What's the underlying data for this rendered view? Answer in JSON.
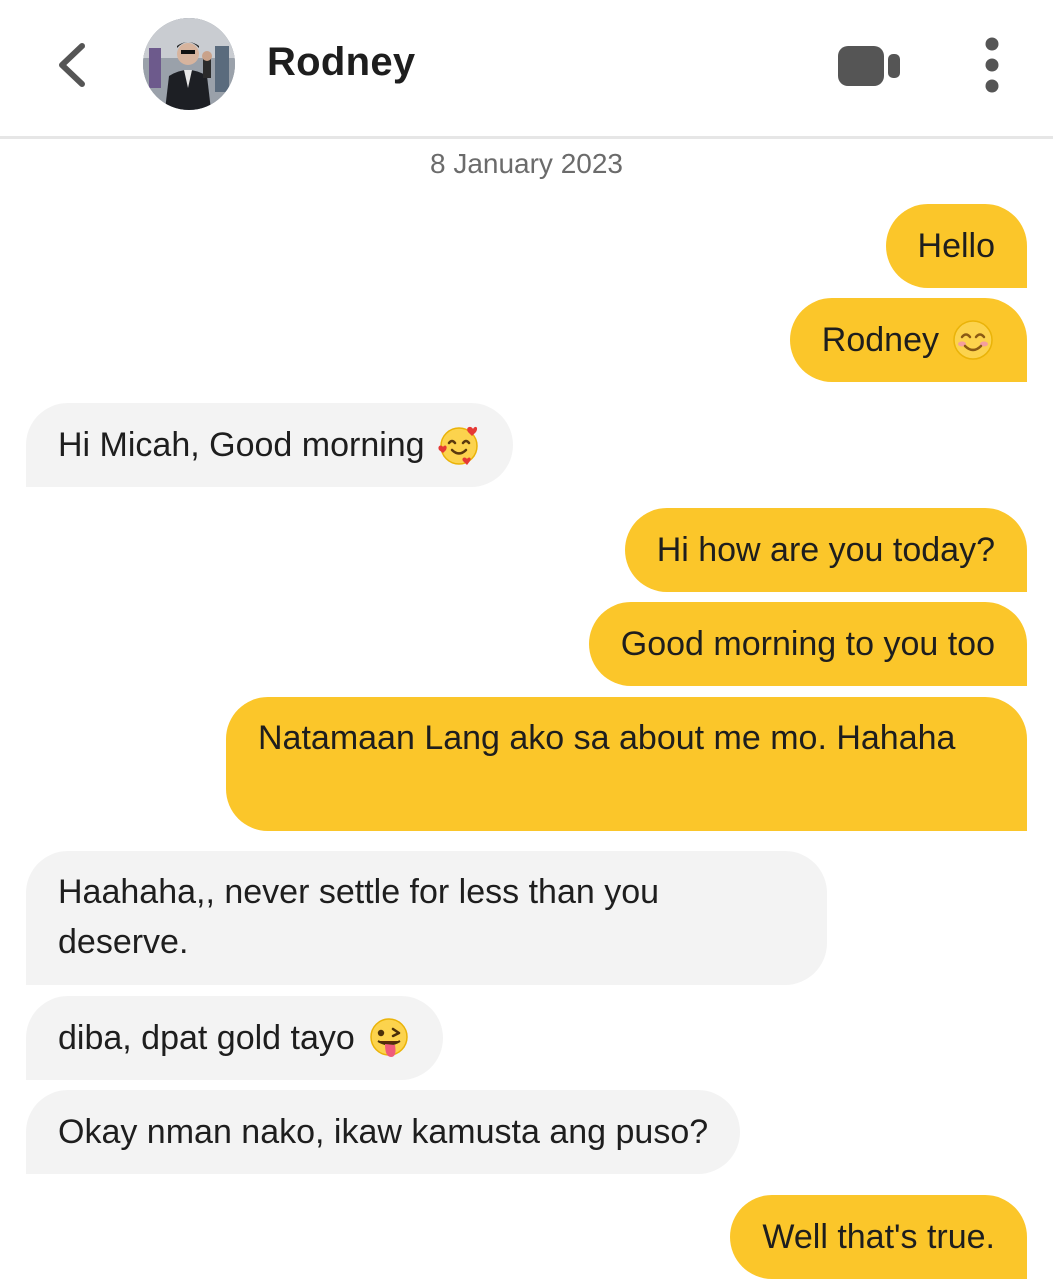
{
  "header": {
    "contact_name": "Rodney",
    "back_icon": "chevron-left-icon",
    "video_icon": "video-camera-icon",
    "more_icon": "more-vertical-icon"
  },
  "date_separator": "8 January 2023",
  "messages": [
    {
      "side": "out",
      "text": "Hello"
    },
    {
      "side": "out",
      "text": "Rodney",
      "emoji": "smiling-face-with-smiling-eyes"
    },
    {
      "side": "in",
      "text": "Hi Micah, Good morning",
      "emoji": "smiling-face-with-hearts"
    },
    {
      "side": "out",
      "text": "Hi how are you today?"
    },
    {
      "side": "out",
      "text": "Good morning to you too"
    },
    {
      "side": "out",
      "text": "Natamaan Lang ako sa about me mo. Hahaha"
    },
    {
      "side": "in",
      "text": "Haahaha,, never settle for less than you deserve."
    },
    {
      "side": "in",
      "text": "diba, dpat gold tayo",
      "emoji": "winking-face-with-tongue"
    },
    {
      "side": "in",
      "text": "Okay nman nako, ikaw kamusta ang puso?"
    },
    {
      "side": "out",
      "text": "Well that's true."
    }
  ],
  "colors": {
    "outgoing_bubble": "#fbc62a",
    "incoming_bubble": "#f3f3f3",
    "text": "#1e1e1e",
    "date_text": "#6b6b6b"
  }
}
